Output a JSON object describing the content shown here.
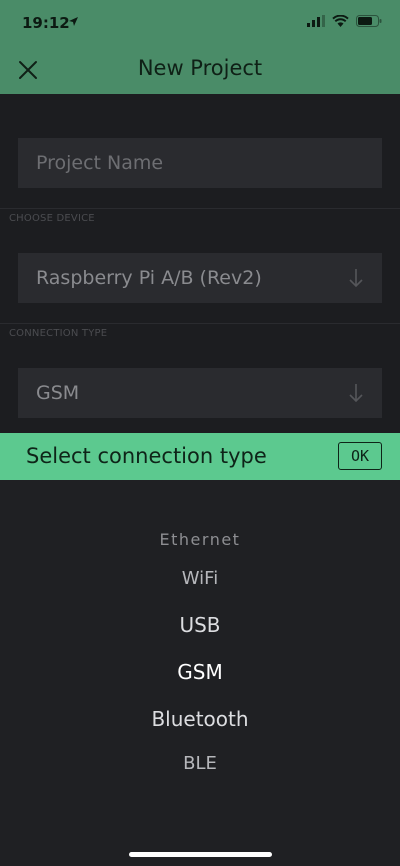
{
  "status": {
    "time": "19:12"
  },
  "header": {
    "title": "New Project"
  },
  "form": {
    "project_name_placeholder": "Project Name",
    "device_label": "CHOOSE DEVICE",
    "device_value": "Raspberry Pi A/B (Rev2)",
    "connection_label": "CONNECTION TYPE",
    "connection_value": "GSM"
  },
  "picker": {
    "title": "Select connection type",
    "ok_label": "OK",
    "options": [
      "Ethernet",
      "WiFi",
      "USB",
      "GSM",
      "Bluetooth",
      "BLE"
    ],
    "selected": "GSM"
  },
  "colors": {
    "header": "#4a8c68",
    "picker_bar": "#5cc98f",
    "background": "#1f2023"
  }
}
